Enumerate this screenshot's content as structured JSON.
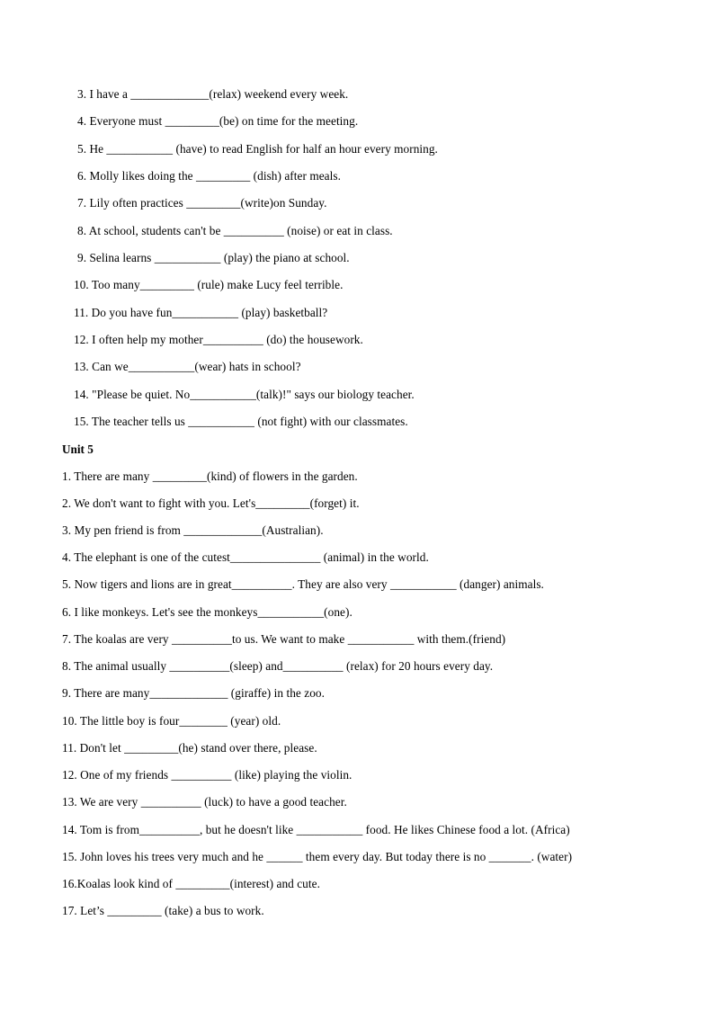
{
  "document": {
    "type": "grammar-worksheet",
    "page_background": "#ffffff",
    "text_color": "#000000",
    "sections": [
      {
        "id": "section-continued",
        "heading": null,
        "items": [
          {
            "number": "3.",
            "text": "3. I have a _____________(relax) weekend every week."
          },
          {
            "number": "4.",
            "text": "4. Everyone must _________(be) on time for the meeting."
          },
          {
            "number": "5.",
            "text": "5. He ___________ (have) to read English for half an hour every morning."
          },
          {
            "number": "6.",
            "text": "6. Molly likes doing the _________ (dish) after meals."
          },
          {
            "number": "7.",
            "text": "7. Lily often practices _________(write)on Sunday."
          },
          {
            "number": "8.",
            "text": "8. At school, students can't be __________ (noise) or eat in class."
          },
          {
            "number": "9.",
            "text": "9. Selina learns ___________ (play) the piano at school."
          },
          {
            "number": "10.",
            "text": "10. Too many_________ (rule) make Lucy feel terrible."
          },
          {
            "number": "11.",
            "text": "11. Do you have fun___________ (play) basketball?"
          },
          {
            "number": "12.",
            "text": "12. I often help my mother__________ (do) the housework."
          },
          {
            "number": "13.",
            "text": "13. Can we___________(wear) hats in school?"
          },
          {
            "number": "14.",
            "text": "14. \"Please be quiet. No___________(talk)!\" says our biology teacher."
          },
          {
            "number": "15.",
            "text": "15. The teacher tells us ___________ (not fight) with our classmates."
          }
        ]
      },
      {
        "id": "section-unit-5",
        "heading": "Unit 5",
        "items": [
          {
            "number": "1.",
            "text": "1. There are many _________(kind) of flowers in the garden."
          },
          {
            "number": "2.",
            "text": "2. We don't want to fight with you. Let's_________(forget) it."
          },
          {
            "number": "3.",
            "text": "3. My pen friend is from _____________(Australian)."
          },
          {
            "number": "4.",
            "text": "4. The elephant is one of the cutest_______________ (animal) in the world."
          },
          {
            "number": "5.",
            "text": "5. Now tigers and lions are in great__________. They are also very ___________ (danger) animals."
          },
          {
            "number": "6.",
            "text": "6. I like monkeys. Let's see the monkeys___________(one)."
          },
          {
            "number": "7.",
            "text": "7. The koalas are very __________to us. We want to make ___________ with them.(friend)"
          },
          {
            "number": "8.",
            "text": "8. The animal usually __________(sleep) and__________ (relax) for 20 hours every day."
          },
          {
            "number": "9.",
            "text": "9. There are many_____________  (giraffe) in the zoo."
          },
          {
            "number": "10.",
            "text": "10. The little boy is four________ (year) old."
          },
          {
            "number": "11.",
            "text": "11. Don't let _________(he) stand over there, please."
          },
          {
            "number": "12.",
            "text": "12. One of my friends __________ (like) playing the violin."
          },
          {
            "number": "13.",
            "text": "13. We are very __________ (luck) to have a good teacher."
          },
          {
            "number": "14.",
            "text": "14. Tom is from__________, but he doesn't like ___________ food. He likes Chinese food a lot. (Africa)"
          },
          {
            "number": "15.",
            "text": "15. John loves his trees very much and he ______ them every day. But today there is no _______. (water)"
          },
          {
            "number": "16.",
            "text": "16.Koalas look kind of _________(interest) and cute."
          },
          {
            "number": "17.",
            "text": "17. Let’s _________ (take) a bus to work."
          }
        ]
      }
    ]
  }
}
